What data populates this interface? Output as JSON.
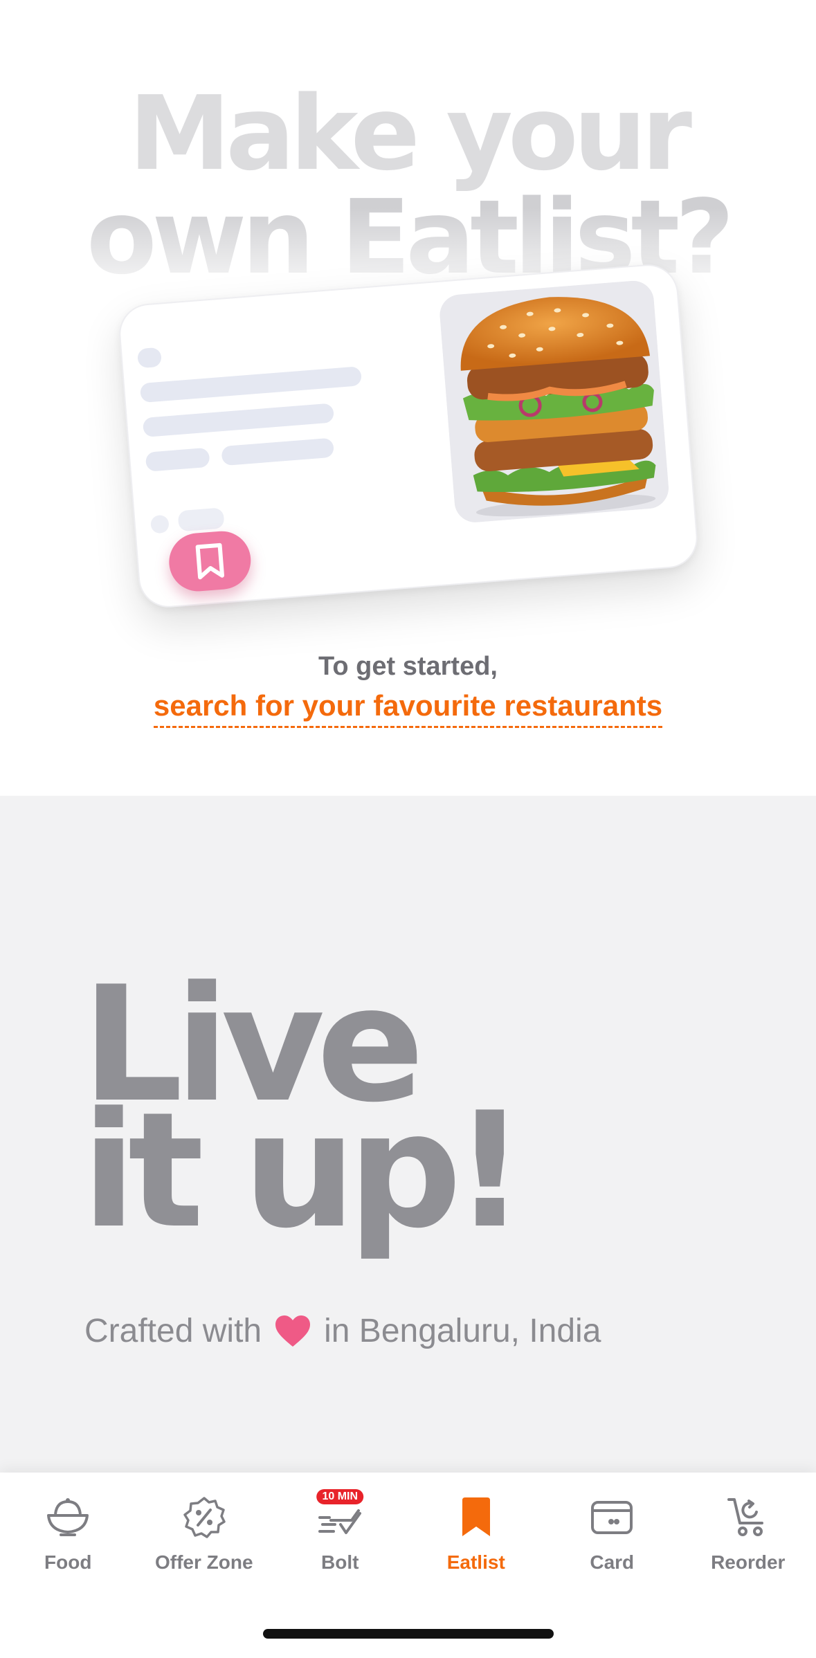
{
  "hero": {
    "headline_line1": "Make your",
    "headline_line2": "own Eatlist?",
    "cta_line1": "To get started,",
    "cta_link": "search for your favourite restaurants"
  },
  "footer": {
    "tagline_line1": "Live",
    "tagline_line2": "it up!",
    "crafted_prefix": "Crafted with",
    "crafted_suffix": "in Bengaluru, India",
    "heart_icon": "heart-icon"
  },
  "tabs": [
    {
      "label": "Food",
      "icon": "food-bowl-icon",
      "active": false
    },
    {
      "label": "Offer Zone",
      "icon": "offer-badge-icon",
      "active": false
    },
    {
      "label": "Bolt",
      "icon": "bolt-delivery-icon",
      "active": false,
      "badge": "10 MIN"
    },
    {
      "label": "Eatlist",
      "icon": "bookmark-icon",
      "active": true
    },
    {
      "label": "Card",
      "icon": "card-icon",
      "active": false
    },
    {
      "label": "Reorder",
      "icon": "reorder-cart-icon",
      "active": false
    }
  ],
  "colors": {
    "accent": "#f46a0c",
    "bookmark_pink": "#f07aa4",
    "heart": "#ef5a86",
    "badge_red": "#e8232a"
  }
}
